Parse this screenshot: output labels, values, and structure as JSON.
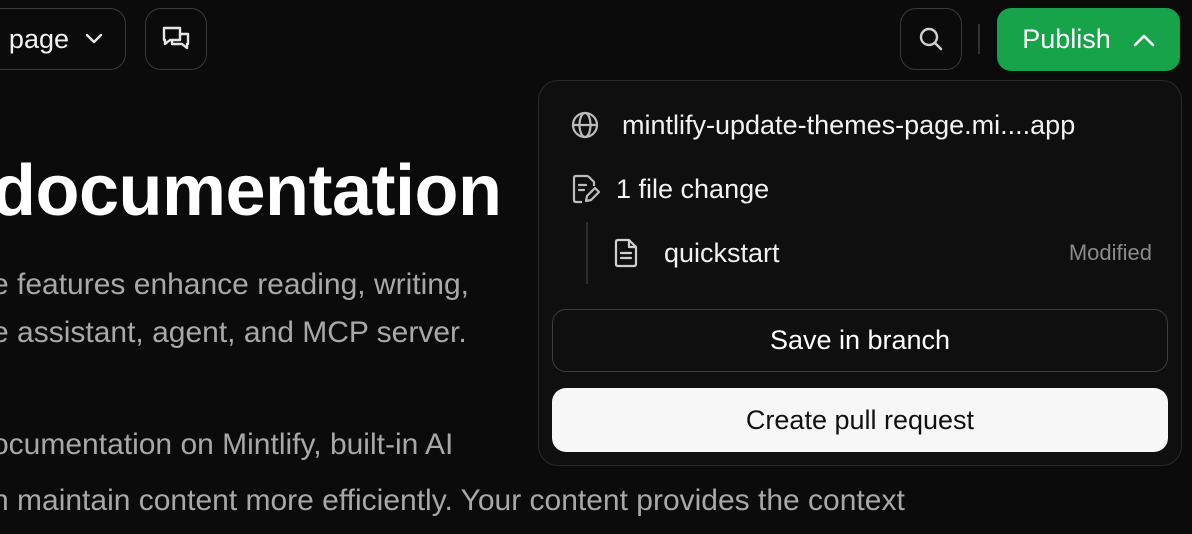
{
  "topbar": {
    "page_dropdown_label": "page",
    "publish_label": "Publish"
  },
  "document": {
    "title": "documentation",
    "lines": [
      "e features enhance reading, writing,",
      "e assistant, agent, and MCP server.",
      "ocumentation on Mintlify, built-in AI",
      "n maintain content more efficiently. Your content provides the context"
    ]
  },
  "publish_popover": {
    "deployment_url": "mintlify-update-themes-page.mi....app",
    "change_summary": "1 file change",
    "files": [
      {
        "name": "quickstart",
        "status": "Modified"
      }
    ],
    "save_branch_label": "Save in branch",
    "create_pr_label": "Create pull request"
  },
  "icons": {
    "dropdown": "chevron-down-icon",
    "chat": "messages-icon",
    "search": "search-icon",
    "publish_toggle": "chevron-up-icon",
    "url": "globe-icon",
    "changes": "file-edit-icon",
    "file": "file-text-icon"
  },
  "colors": {
    "background": "#0b0b0b",
    "publish_green": "#16a34a",
    "muted_text": "#a8a8a8"
  }
}
